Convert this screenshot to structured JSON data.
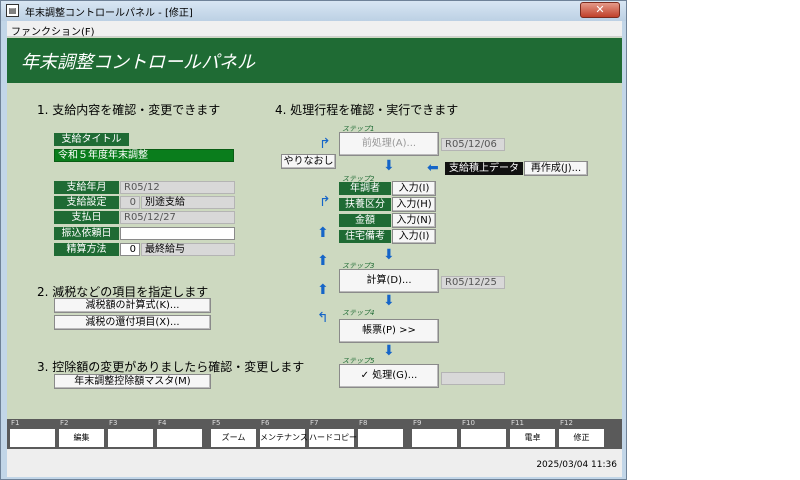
{
  "window": {
    "title": "年末調整コントロールパネル - [修正]",
    "close_label": "✕"
  },
  "menu": {
    "function": "ファンクション(F)"
  },
  "banner": {
    "title": "年末調整コントロールパネル"
  },
  "section1": {
    "heading": "1. 支給内容を確認・変更できます",
    "title_label": "支給タイトル",
    "title_value": "令和５年度年末調整",
    "rows": [
      {
        "label": "支給年月",
        "value": "R05/12"
      },
      {
        "label": "支給設定",
        "code": "0",
        "value": "別途支給"
      },
      {
        "label": "支払日",
        "value": "R05/12/27"
      },
      {
        "label": "振込依頼日",
        "value": ""
      },
      {
        "label": "精算方法",
        "code": "0",
        "value": "最終給与"
      }
    ]
  },
  "section2": {
    "heading": "2. 減税などの項目を指定します",
    "btn_formula": "減税額の計算式(K)...",
    "btn_items": "減税の還付項目(X)..."
  },
  "section3": {
    "heading": "3. 控除額の変更がありましたら確認・変更します",
    "btn_master": "年末調整控除額マスタ(M)"
  },
  "section4": {
    "heading": "4. 処理行程を確認・実行できます",
    "step1": "ステップ1",
    "step2": "ステップ2",
    "step3": "ステップ3",
    "step4": "ステップ4",
    "step5": "ステップ5",
    "btn_pre": "前処理(A)...",
    "pre_date": "R05/12/06",
    "btn_redo": "やりなおし",
    "data_label": "支給積上データ",
    "btn_recreate": "再作成(J)...",
    "inputs": [
      {
        "label": "年調者",
        "btn": "入力(I)"
      },
      {
        "label": "扶養区分",
        "btn": "入力(H)"
      },
      {
        "label": "金額",
        "btn": "入力(N)"
      },
      {
        "label": "住宅備考",
        "btn": "入力(I)"
      }
    ],
    "btn_calc": "計算(D)...",
    "calc_date": "R05/12/25",
    "btn_report": "帳票(P) >>",
    "btn_process": "✓ 処理(G)...",
    "process_date": ""
  },
  "fkeys": [
    {
      "num": "F1",
      "label": ""
    },
    {
      "num": "F2",
      "label": "編集"
    },
    {
      "num": "F3",
      "label": ""
    },
    {
      "num": "F4",
      "label": ""
    },
    {
      "num": "F5",
      "label": "ズーム"
    },
    {
      "num": "F6",
      "label": "メンテナンス"
    },
    {
      "num": "F7",
      "label": "ハードコピー"
    },
    {
      "num": "F8",
      "label": ""
    },
    {
      "num": "F9",
      "label": ""
    },
    {
      "num": "F10",
      "label": ""
    },
    {
      "num": "F11",
      "label": "電卓"
    },
    {
      "num": "F12",
      "label": "修正"
    }
  ],
  "status": {
    "datetime": "2025/03/04  11:36"
  },
  "colors": {
    "banner": "#1f6b34",
    "background": "#cdd9c0",
    "arrow": "#1565c8"
  }
}
